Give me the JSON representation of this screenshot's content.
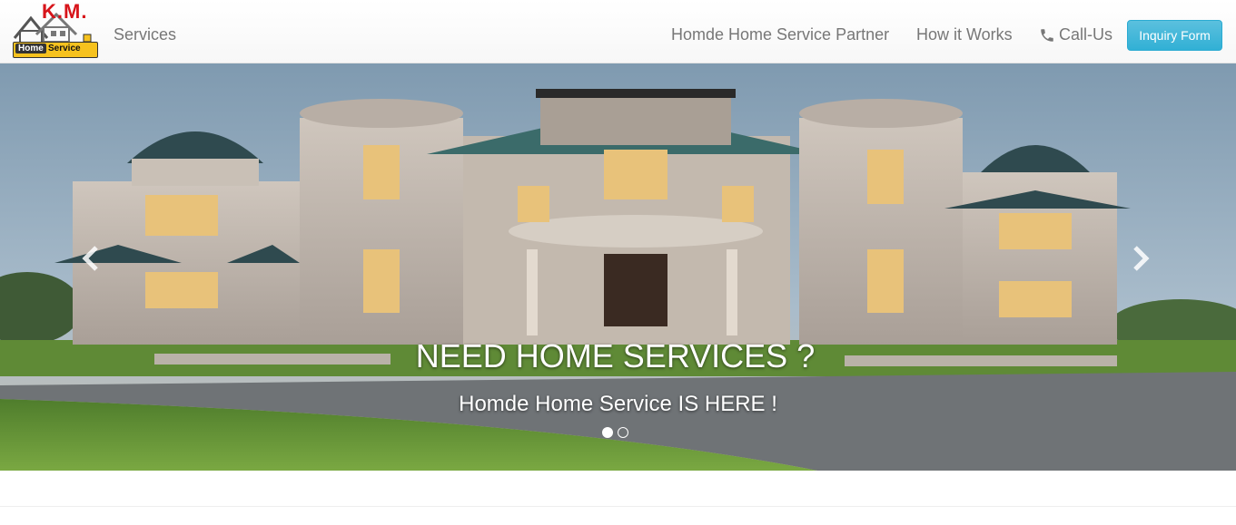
{
  "navbar": {
    "logo": {
      "brand_mark": "K.M.",
      "badge_home": "Home",
      "badge_service": "Service"
    },
    "links": {
      "services": "Services",
      "partner": "Homde Home Service Partner",
      "how_it_works": "How it Works",
      "call_us": "Call-Us"
    },
    "inquiry_button": "Inquiry Form",
    "icons": {
      "call": "phone-icon"
    }
  },
  "carousel": {
    "title": "NEED HOME SERVICES ?",
    "subtitle": "Homde Home Service IS HERE !",
    "indicator_count": 2,
    "active_indicator": 0,
    "icons": {
      "prev": "chevron-left-icon",
      "next": "chevron-right-icon"
    }
  },
  "colors": {
    "nav_text": "#777777",
    "button_accent": "#5bc0de",
    "logo_red": "#d7141a",
    "logo_yellow": "#f6c21e"
  }
}
